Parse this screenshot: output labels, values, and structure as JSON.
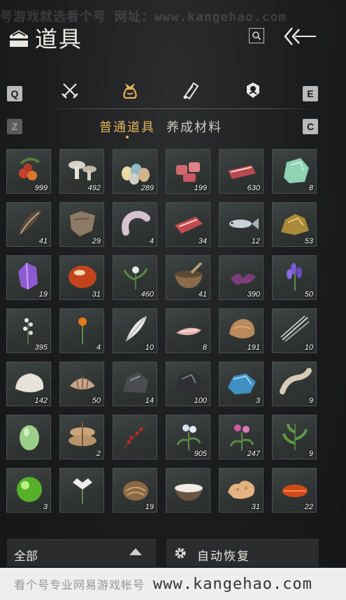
{
  "watermark": {
    "top_text": "号游戏就选看个号  网址：www.kangehao.com",
    "bottom_cn": "看个号专业网易游戏帐号",
    "bottom_url": "www.kangehao.com"
  },
  "header": {
    "title": "道具"
  },
  "category_tabs": {
    "left_key": "Q",
    "right_key": "E",
    "items": [
      {
        "icon": "crossed-swords-icon",
        "active": false
      },
      {
        "icon": "pouch-icon",
        "active": true
      },
      {
        "icon": "scroll-icon",
        "active": false
      },
      {
        "icon": "badge-icon",
        "active": false
      }
    ]
  },
  "sub_tabs": {
    "left_key": "Z",
    "right_key": "C",
    "items": [
      {
        "label": "普通道具",
        "active": true
      },
      {
        "label": "养成材料",
        "active": false
      }
    ]
  },
  "items": [
    {
      "icon": "berries-icon",
      "qty": "999"
    },
    {
      "icon": "mushrooms-icon",
      "qty": "492"
    },
    {
      "icon": "eggs-icon",
      "qty": "289"
    },
    {
      "icon": "meat-chunks-icon",
      "qty": "199"
    },
    {
      "icon": "steak-icon",
      "qty": "630"
    },
    {
      "icon": "jade-stone-icon",
      "qty": "8"
    },
    {
      "icon": "feathers-icon",
      "qty": "41"
    },
    {
      "icon": "hide-icon",
      "qty": "29"
    },
    {
      "icon": "sausage-icon",
      "qty": "4"
    },
    {
      "icon": "raw-meat-icon",
      "qty": "34"
    },
    {
      "icon": "fish-icon",
      "qty": "12"
    },
    {
      "icon": "ore-icon",
      "qty": "53"
    },
    {
      "icon": "amethyst-icon",
      "qty": "19"
    },
    {
      "icon": "amber-orb-icon",
      "qty": "31"
    },
    {
      "icon": "herb-white-flower-icon",
      "qty": "460"
    },
    {
      "icon": "mortar-icon",
      "qty": "41"
    },
    {
      "icon": "purple-petals-icon",
      "qty": "390"
    },
    {
      "icon": "lavender-icon",
      "qty": "50"
    },
    {
      "icon": "white-flowers-icon",
      "qty": "395"
    },
    {
      "icon": "orange-flower-icon",
      "qty": "4"
    },
    {
      "icon": "white-feather-icon",
      "qty": "10"
    },
    {
      "icon": "fillet-icon",
      "qty": "8"
    },
    {
      "icon": "fur-icon",
      "qty": "191"
    },
    {
      "icon": "quills-icon",
      "qty": "10"
    },
    {
      "icon": "white-fur-icon",
      "qty": "142"
    },
    {
      "icon": "shell-icon",
      "qty": "50"
    },
    {
      "icon": "dark-rock-icon",
      "qty": "14"
    },
    {
      "icon": "coal-icon",
      "qty": "100"
    },
    {
      "icon": "blue-crystal-icon",
      "qty": "3"
    },
    {
      "icon": "bone-icon",
      "qty": "9"
    },
    {
      "icon": "green-gourd-icon",
      "qty": ""
    },
    {
      "icon": "sacks-icon",
      "qty": "2"
    },
    {
      "icon": "red-berries-branch-icon",
      "qty": ""
    },
    {
      "icon": "white-blossom-herb-icon",
      "qty": "905"
    },
    {
      "icon": "pink-flower-herb-icon",
      "qty": "247"
    },
    {
      "icon": "green-herb-icon",
      "qty": "9"
    },
    {
      "icon": "green-orb-icon",
      "qty": "3"
    },
    {
      "icon": "white-lily-icon",
      "qty": ""
    },
    {
      "icon": "wood-burl-icon",
      "qty": "19"
    },
    {
      "icon": "rice-bowl-icon",
      "qty": ""
    },
    {
      "icon": "sponge-icon",
      "qty": "31"
    },
    {
      "icon": "red-leaf-icon",
      "qty": "22"
    }
  ],
  "footer": {
    "filter_label": "全部",
    "auto_label": "自动恢复"
  },
  "colors": {
    "accent": "#e2b35a",
    "background": "#1b1c1e"
  }
}
